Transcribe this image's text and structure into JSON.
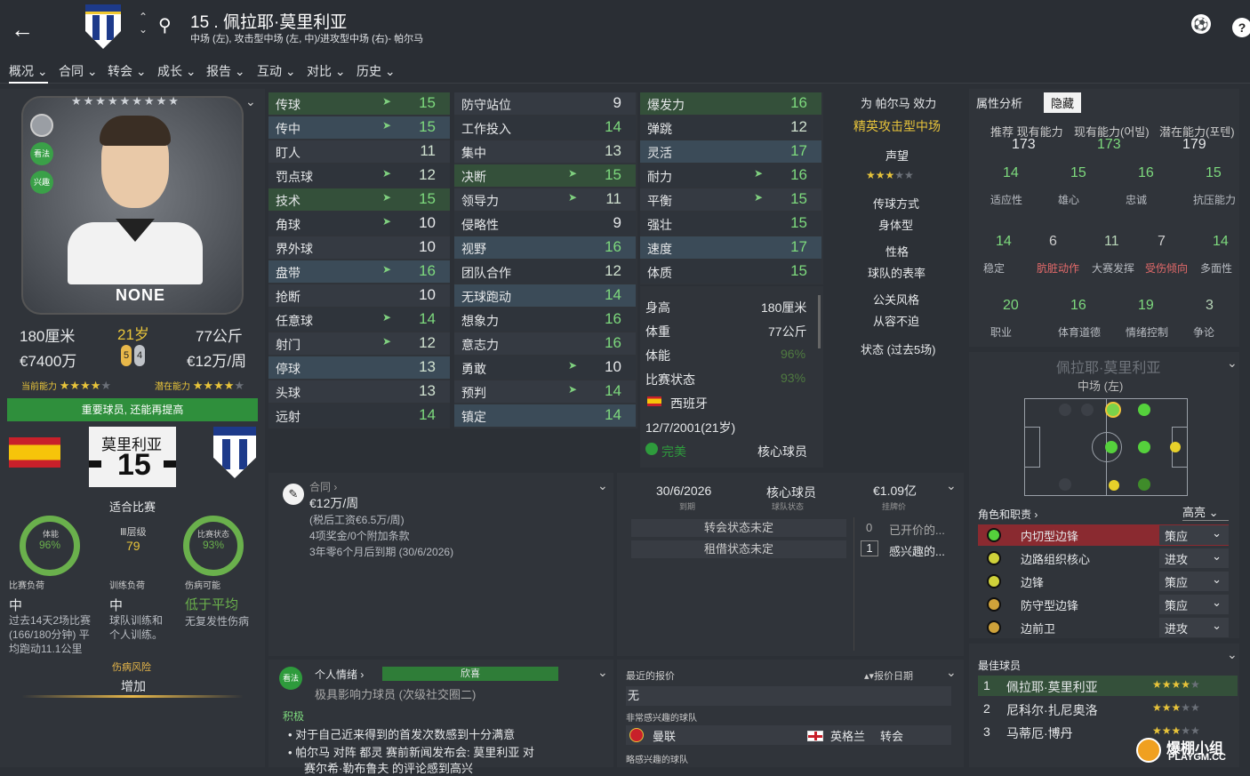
{
  "header": {
    "number_name": "15 . 佩拉耶·莫里利亚",
    "positions": "中场 (左), 攻击型中场 (左, 中)/进攻型中场 (右)- 帕尔马",
    "club_badge_text": "PARMA CALCIO"
  },
  "nav": [
    "概况",
    "合同",
    "转会",
    "成长",
    "报告",
    "互动",
    "对比",
    "历史"
  ],
  "profile": {
    "stars_top": "★★★★★★★★★",
    "shirt_name": "NONE",
    "height": "180厘米",
    "age": "21岁",
    "weight": "77公斤",
    "value": "€7400万",
    "wage": "€12万/周",
    "foot_left": "5",
    "foot_right": "4",
    "ca_label": "当前能力",
    "pa_label": "潜在能力",
    "status_banner": "重要球员, 还能再提高",
    "badge_watch": "看法",
    "badge_interest": "兴趣"
  },
  "card": {
    "surname": "莫里利亚",
    "number": "15",
    "fit": "适合比赛"
  },
  "fitness": [
    {
      "label": "体能",
      "value": "96%"
    },
    {
      "label": "比赛状态",
      "value": "93%"
    }
  ],
  "training": {
    "title": "Ⅲ层级",
    "value": "79"
  },
  "loads": [
    {
      "title": "比赛负荷",
      "val": "中",
      "desc": "过去14天2场比赛 (166/180分钟) 平均跑动11.1公里"
    },
    {
      "title": "训练负荷",
      "val": "中",
      "desc": "球队训练和个人训练。"
    },
    {
      "title": "伤病可能",
      "val": "低于平均",
      "desc": "无复发性伤病"
    }
  ],
  "injury": {
    "label": "伤病风险",
    "value": "增加"
  },
  "tech": [
    [
      "传球",
      "15"
    ],
    [
      "传中",
      "15"
    ],
    [
      "盯人",
      "11"
    ],
    [
      "罚点球",
      "12"
    ],
    [
      "技术",
      "15"
    ],
    [
      "角球",
      "10"
    ],
    [
      "界外球",
      "10"
    ],
    [
      "盘带",
      "16"
    ],
    [
      "抢断",
      "10"
    ],
    [
      "任意球",
      "14"
    ],
    [
      "射门",
      "12"
    ],
    [
      "停球",
      "13"
    ],
    [
      "头球",
      "13"
    ],
    [
      "远射",
      "14"
    ]
  ],
  "mental": [
    [
      "防守站位",
      "9"
    ],
    [
      "工作投入",
      "14"
    ],
    [
      "集中",
      "13"
    ],
    [
      "决断",
      "15"
    ],
    [
      "领导力",
      "11"
    ],
    [
      "侵略性",
      "9"
    ],
    [
      "视野",
      "16"
    ],
    [
      "团队合作",
      "12"
    ],
    [
      "无球跑动",
      "14"
    ],
    [
      "想象力",
      "16"
    ],
    [
      "意志力",
      "16"
    ],
    [
      "勇敢",
      "10"
    ],
    [
      "预判",
      "14"
    ],
    [
      "镇定",
      "14"
    ]
  ],
  "physical": [
    [
      "爆发力",
      "16"
    ],
    [
      "弹跳",
      "12"
    ],
    [
      "灵活",
      "17"
    ],
    [
      "耐力",
      "16"
    ],
    [
      "平衡",
      "15"
    ],
    [
      "强壮",
      "15"
    ],
    [
      "速度",
      "17"
    ],
    [
      "体质",
      "15"
    ]
  ],
  "info": {
    "height_l": "身高",
    "height_v": "180厘米",
    "weight_l": "体重",
    "weight_v": "77公斤",
    "fit_l": "体能",
    "fit_v": "96%",
    "form_l": "比赛状态",
    "form_v": "93%",
    "nation": "西班牙",
    "dob": "12/7/2001(21岁)",
    "happy": "完美",
    "role": "核心球员"
  },
  "side": {
    "efficiency_title": "为 帕尔马 效力",
    "efficiency_val": "精英攻击型中场",
    "reputation": "声望",
    "pass_style": "传球方式",
    "body": "身体型",
    "personality": "性格",
    "team_perf": "球队的表率",
    "media": "公关风格",
    "media_val": "从容不迫",
    "form5": "状态 (过去5场)"
  },
  "attr_analysis": {
    "tab1": "属性分析",
    "tab2": "隐藏",
    "ca_l": "推荐 现有能力",
    "ca_v": "173",
    "ca2_l": "现有能力(어빌)",
    "ca2_v": "173",
    "pa_l": "潜在能力(포텐)",
    "pa_v": "179"
  },
  "hidden": [
    [
      "14",
      "适应性"
    ],
    [
      "15",
      "雄心"
    ],
    [
      "16",
      "忠诚"
    ],
    [
      "15",
      "抗压能力"
    ],
    [
      "14",
      "稳定"
    ],
    [
      "6",
      "肮脏动作"
    ],
    [
      "11",
      "大赛发挥"
    ],
    [
      "7",
      "受伤倾向"
    ],
    [
      "14",
      "多面性"
    ],
    [
      "20",
      "职业"
    ],
    [
      "16",
      "体育道德"
    ],
    [
      "19",
      "情绪控制"
    ],
    [
      "3",
      "争论"
    ]
  ],
  "pitch_panel": {
    "name": "佩拉耶·莫里利亚",
    "pos": "中场 (左)"
  },
  "roles_header": {
    "label": "角色和职责",
    "mode": "高亮"
  },
  "roles": [
    [
      "内切型边锋",
      "策应"
    ],
    [
      "边路组织核心",
      "进攻"
    ],
    [
      "边锋",
      "策应"
    ],
    [
      "防守型边锋",
      "策应"
    ],
    [
      "边前卫",
      "进攻"
    ]
  ],
  "contract": {
    "title": "合同",
    "wage": "€12万/周",
    "tax": "(税后工资€6.5万/周)",
    "bonus": "4项奖金/0个附加条款",
    "expiry": "3年零6个月后到期 (30/6/2026)"
  },
  "transfer": {
    "date": "30/6/2026",
    "date_l": "到期",
    "status": "核心球员",
    "status_l": "球队状态",
    "value": "€1.09亿",
    "value_l": "挂牌价",
    "t1": "转会状态未定",
    "t2": "租借状态未定",
    "o1n": "0",
    "o1": "已开价的...",
    "o2n": "1",
    "o2": "感兴趣的..."
  },
  "feelings": {
    "badge": "看法",
    "title": "个人情绪",
    "mood": "欣喜",
    "sub": "极具影响力球员 (次级社交圈二)",
    "pos_l": "积极",
    "p1": "对于自己近来得到的首发次数感到十分满意",
    "p2": "帕尔马 对阵 都灵 赛前新闻发布会: 莫里利亚 对",
    "p3": "赛尔希·勒布鲁夫 的评论感到高兴"
  },
  "offers": {
    "title": "最近的报价",
    "date_l": "报价日期",
    "none": "无",
    "very_l": "非常感兴趣的球队",
    "club": "曼联",
    "country": "英格兰",
    "act": "转会",
    "slight_l": "略感兴趣的球队"
  },
  "best": {
    "title": "最佳球员",
    "rows": [
      [
        "1",
        "佩拉耶·莫里利亚"
      ],
      [
        "2",
        "尼科尔·扎尼奥洛"
      ],
      [
        "3",
        "马蒂厄·博丹"
      ]
    ]
  },
  "watermark": {
    "line1": "爆棚小组",
    "line2": "PLAYGM.CC"
  }
}
